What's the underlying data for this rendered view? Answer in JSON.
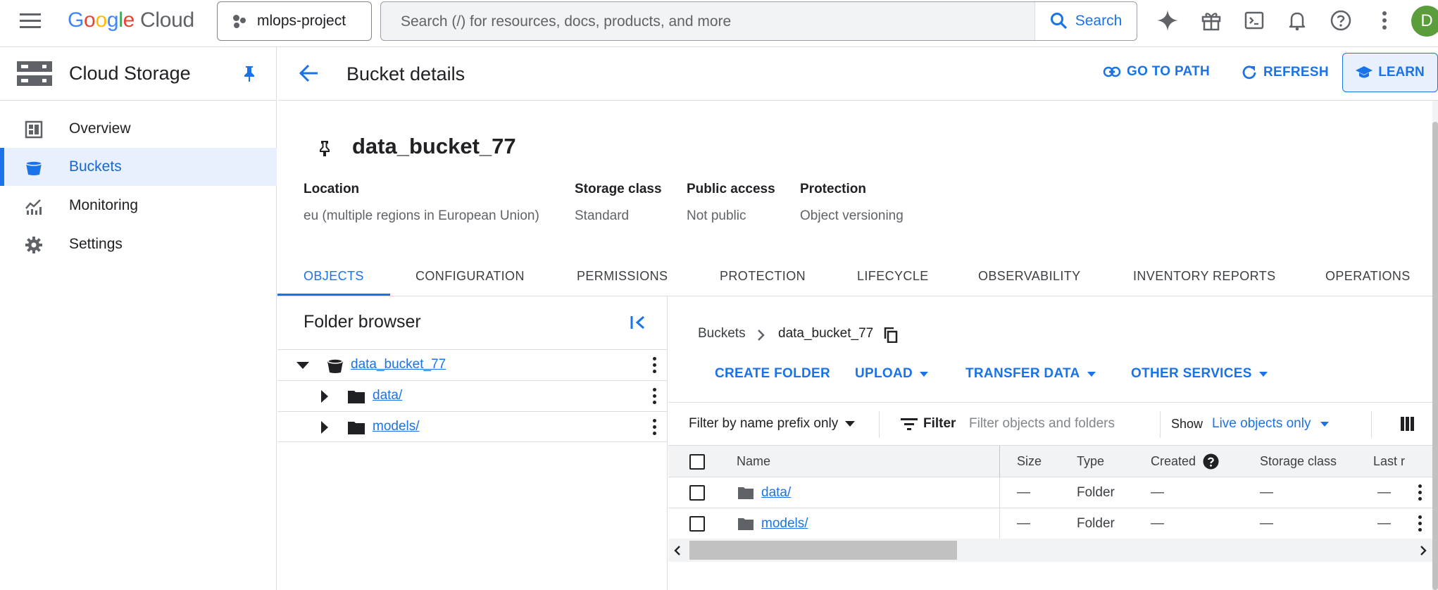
{
  "topbar": {
    "logo_google": [
      "G",
      "o",
      "o",
      "g",
      "l",
      "e"
    ],
    "logo_cloud": "Cloud",
    "project": "mlops-project",
    "search_placeholder": "Search (/) for resources, docs, products, and more",
    "search_button": "Search",
    "avatar_initial": "D",
    "icons": [
      "menu-icon",
      "gemini-sparkle-icon",
      "gift-icon",
      "cloud-shell-icon",
      "notifications-icon",
      "help-icon",
      "more-vert-icon"
    ]
  },
  "sidebar": {
    "title": "Cloud Storage",
    "items": [
      {
        "label": "Overview",
        "icon": "dashboard-icon"
      },
      {
        "label": "Buckets",
        "icon": "bucket-icon",
        "active": true
      },
      {
        "label": "Monitoring",
        "icon": "monitoring-icon"
      },
      {
        "label": "Settings",
        "icon": "settings-icon"
      }
    ]
  },
  "header": {
    "title": "Bucket details",
    "go_to_path": "GO TO PATH",
    "refresh": "REFRESH",
    "learn": "LEARN"
  },
  "bucket": {
    "name": "data_bucket_77",
    "info": [
      {
        "label": "Location",
        "value": "eu (multiple regions in European Union)"
      },
      {
        "label": "Storage class",
        "value": "Standard"
      },
      {
        "label": "Public access",
        "value": "Not public"
      },
      {
        "label": "Protection",
        "value": "Object versioning"
      }
    ]
  },
  "tabs": [
    "OBJECTS",
    "CONFIGURATION",
    "PERMISSIONS",
    "PROTECTION",
    "LIFECYCLE",
    "OBSERVABILITY",
    "INVENTORY REPORTS",
    "OPERATIONS"
  ],
  "active_tab": "OBJECTS",
  "folder_browser": {
    "title": "Folder browser",
    "root": "data_bucket_77",
    "folders": [
      "data/",
      "models/"
    ]
  },
  "objects": {
    "breadcrumb_root": "Buckets",
    "breadcrumb_current": "data_bucket_77",
    "actions": {
      "create_folder": "CREATE FOLDER",
      "upload": "UPLOAD",
      "transfer_data": "TRANSFER DATA",
      "other_services": "OTHER SERVICES"
    },
    "filter_mode": "Filter by name prefix only",
    "filter_label": "Filter",
    "filter_placeholder": "Filter objects and folders",
    "show_label": "Show",
    "show_value": "Live objects only",
    "columns": [
      "Name",
      "Size",
      "Type",
      "Created",
      "Storage class",
      "Last r"
    ],
    "rows": [
      {
        "name": "data/",
        "size": "—",
        "type": "Folder",
        "created": "—",
        "storage_class": "—",
        "last": "—"
      },
      {
        "name": "models/",
        "size": "—",
        "type": "Folder",
        "created": "—",
        "storage_class": "—",
        "last": "—"
      }
    ]
  },
  "colors": {
    "accent": "#1a73e8",
    "active_bg": "#e8f0fe",
    "border": "#dadce0"
  }
}
